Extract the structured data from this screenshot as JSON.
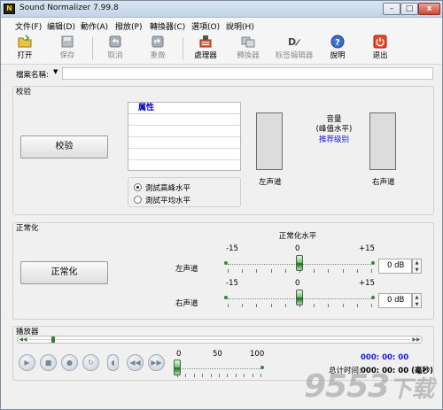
{
  "window": {
    "title": "Sound Normalizer 7.99.8",
    "icon_text": "N",
    "min": "–",
    "max": "□",
    "close": "x"
  },
  "menu": [
    "文件(F)",
    "编辑(D)",
    "動作(A)",
    "撥放(P)",
    "轉換器(C)",
    "選項(O)",
    "說明(H)"
  ],
  "toolbar": {
    "open": "打开",
    "save": "保存",
    "cancel": "取消",
    "reset": "重做",
    "processor": "處理器",
    "converter": "轉換器",
    "tag_editor": "标签编辑器",
    "help": "說明",
    "exit": "退出"
  },
  "file": {
    "label": "檔案名稱:",
    "caret": "▼",
    "value": ""
  },
  "verify": {
    "section": "校验",
    "button": "校验",
    "properties_header": "属性",
    "radio_peak": "測試高峰水平",
    "radio_avg": "測試平均水平",
    "left_channel": "左声道",
    "right_channel": "右声道",
    "volume_title": "音量",
    "volume_sub": "(峰值水平)",
    "recommended": "推荐级别"
  },
  "normalize": {
    "section": "正常化",
    "button": "正常化",
    "level_title": "正常化水平",
    "left_label": "左声道",
    "right_label": "右声道",
    "scale_min": "-15",
    "scale_mid": "0",
    "scale_max": "+15",
    "left_value": "0 dB",
    "right_value": "0 dB",
    "left_level_db": 0,
    "right_level_db": 0
  },
  "player": {
    "section": "播放器",
    "vol_scale": [
      "0",
      "50",
      "100"
    ],
    "volume_level": 0,
    "position_fraction": 0.06,
    "time_current": "000: 00: 00",
    "total_label": "总计时间:",
    "total_value": "000: 00: 00 (毫秒)"
  },
  "watermark": {
    "digits": "9553",
    "suffix": "下载"
  }
}
